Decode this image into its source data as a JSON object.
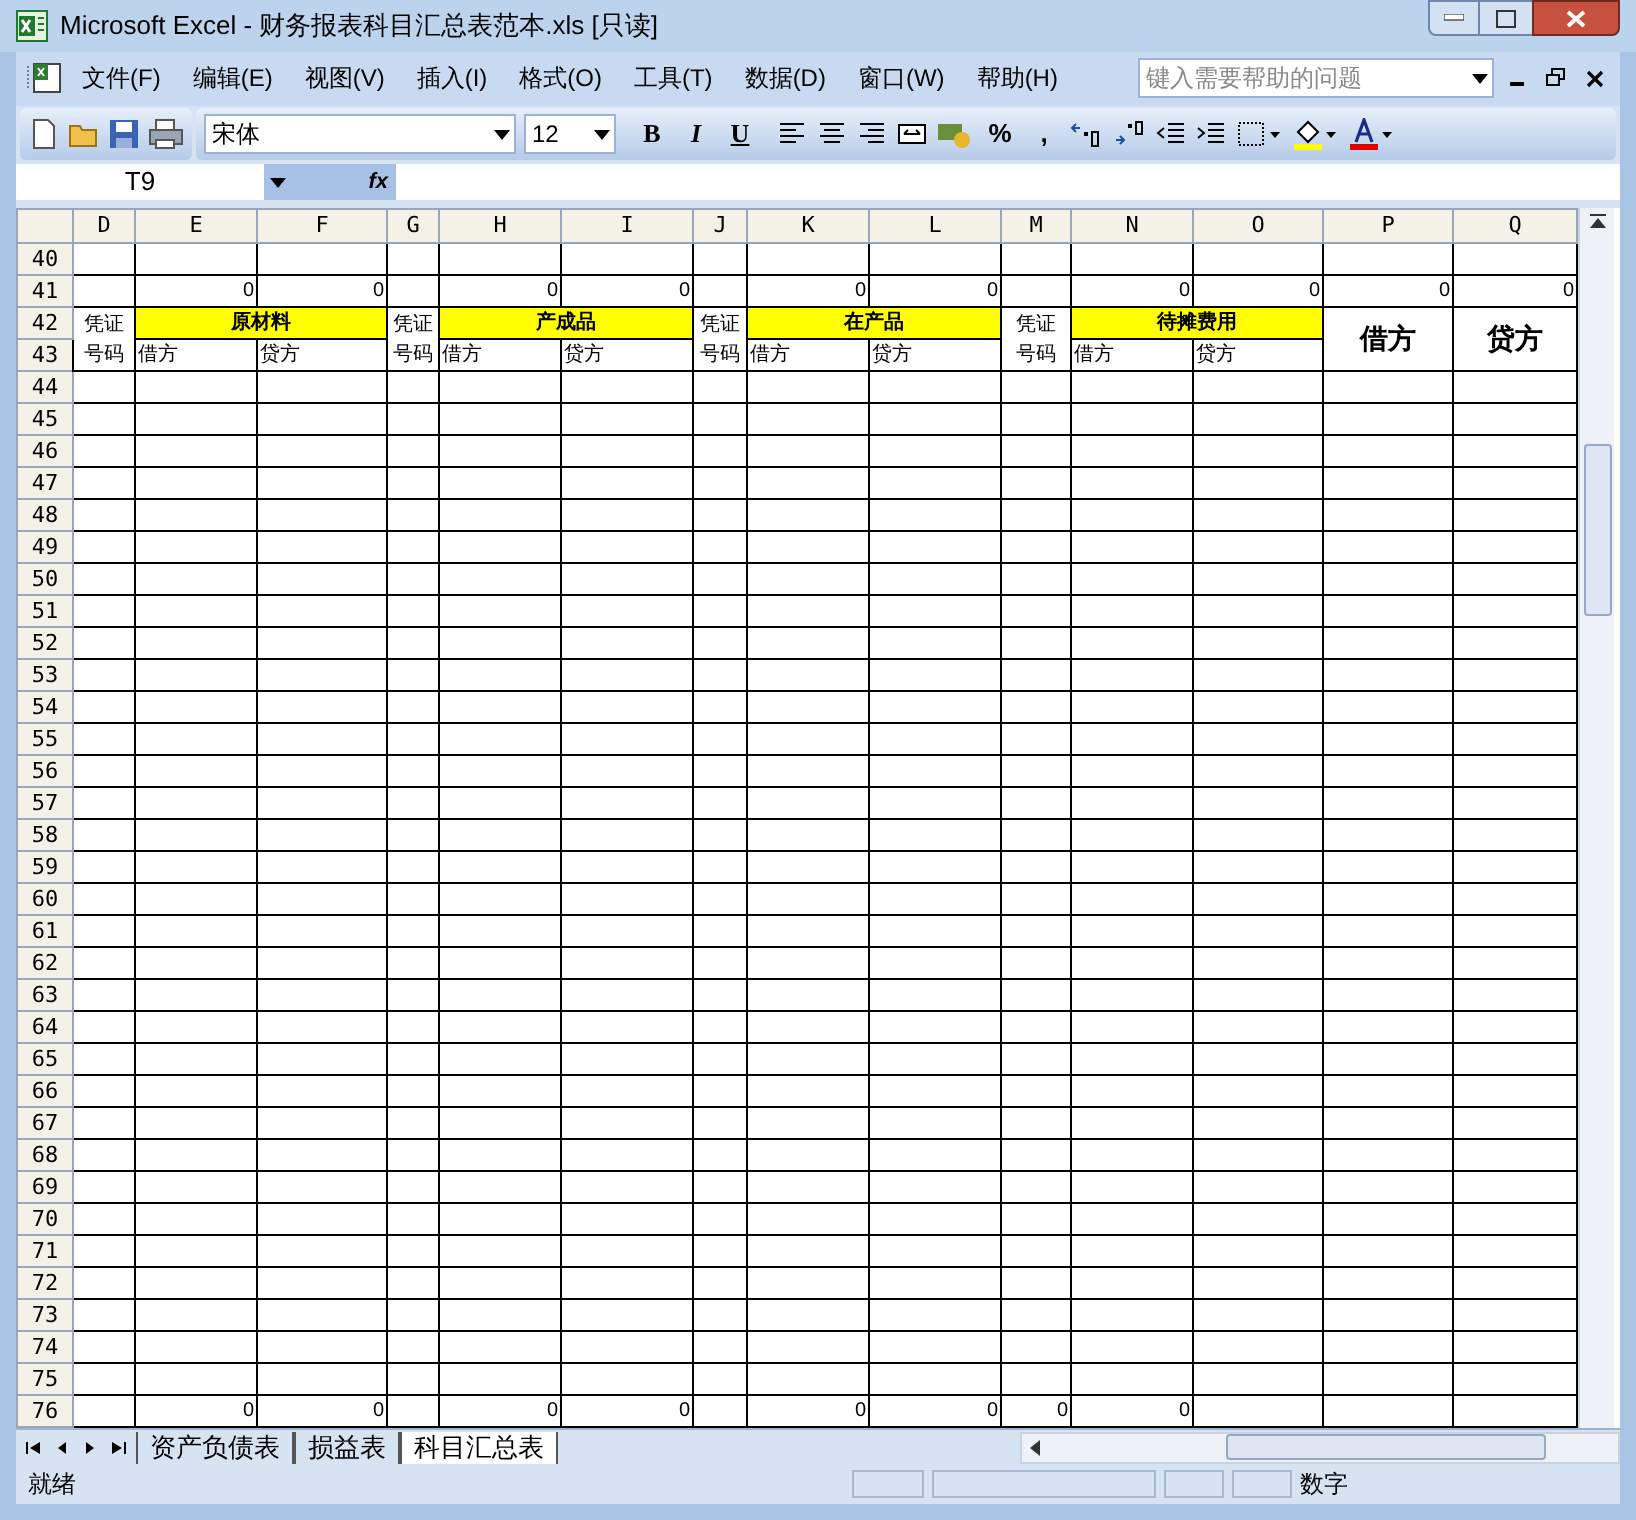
{
  "window": {
    "title": "Microsoft Excel - 财务报表科目汇总表范本.xls  [只读]"
  },
  "menu": [
    "文件(F)",
    "编辑(E)",
    "视图(V)",
    "插入(I)",
    "格式(O)",
    "工具(T)",
    "数据(D)",
    "窗口(W)",
    "帮助(H)"
  ],
  "help_search": {
    "placeholder": "键入需要帮助的问题"
  },
  "toolbar": {
    "font": "宋体",
    "size": "12",
    "format_buttons": [
      "B",
      "I",
      "U"
    ],
    "number_buttons": [
      "%",
      ","
    ]
  },
  "formula_bar": {
    "name_box": "T9",
    "fx": "fx"
  },
  "sheet": {
    "columns": [
      "D",
      "E",
      "F",
      "G",
      "H",
      "I",
      "J",
      "K",
      "L",
      "M",
      "N",
      "O",
      "P",
      "Q"
    ],
    "rows": [
      {
        "kind": "data",
        "header": "40"
      },
      {
        "kind": "data",
        "header": "41",
        "cells": {
          "E": "0",
          "F": "0",
          "H": "0",
          "I": "0",
          "K": "0",
          "L": "0",
          "N": "0",
          "O": "0",
          "P": "0",
          "Q": "0"
        }
      },
      {
        "kind": "label_block",
        "headers": [
          "42",
          "43"
        ],
        "groups": [
          {
            "voucher": "凭证号码",
            "title": "原材料",
            "debit": "借方",
            "credit": "贷方"
          },
          {
            "voucher": "凭证号码",
            "title": "产成品",
            "debit": "借方",
            "credit": "贷方"
          },
          {
            "voucher": "凭证号码",
            "title": "在产品",
            "debit": "借方",
            "credit": "贷方"
          },
          {
            "voucher": "凭证号码",
            "title": "待摊费用",
            "debit": "借方",
            "credit": "贷方"
          }
        ],
        "totals": [
          "借方",
          "贷方"
        ]
      },
      {
        "kind": "data",
        "header": "44"
      },
      {
        "kind": "data",
        "header": "45"
      },
      {
        "kind": "data",
        "header": "46"
      },
      {
        "kind": "data",
        "header": "47"
      },
      {
        "kind": "data",
        "header": "48"
      },
      {
        "kind": "data",
        "header": "49"
      },
      {
        "kind": "data",
        "header": "50"
      },
      {
        "kind": "data",
        "header": "51"
      },
      {
        "kind": "data",
        "header": "52"
      },
      {
        "kind": "data",
        "header": "53"
      },
      {
        "kind": "data",
        "header": "54"
      },
      {
        "kind": "data",
        "header": "55"
      },
      {
        "kind": "data",
        "header": "56"
      },
      {
        "kind": "data",
        "header": "57"
      },
      {
        "kind": "data",
        "header": "58"
      },
      {
        "kind": "data",
        "header": "59"
      },
      {
        "kind": "data",
        "header": "60"
      },
      {
        "kind": "data",
        "header": "61"
      },
      {
        "kind": "data",
        "header": "62"
      },
      {
        "kind": "data",
        "header": "63"
      },
      {
        "kind": "data",
        "header": "64"
      },
      {
        "kind": "data",
        "header": "65"
      },
      {
        "kind": "data",
        "header": "66"
      },
      {
        "kind": "data",
        "header": "67"
      },
      {
        "kind": "data",
        "header": "68"
      },
      {
        "kind": "data",
        "header": "69"
      },
      {
        "kind": "data",
        "header": "70"
      },
      {
        "kind": "data",
        "header": "71"
      },
      {
        "kind": "data",
        "header": "72"
      },
      {
        "kind": "data",
        "header": "73"
      },
      {
        "kind": "data",
        "header": "74"
      },
      {
        "kind": "data",
        "header": "75"
      },
      {
        "kind": "data",
        "header": "76",
        "cells": {
          "E": "0",
          "F": "0",
          "H": "0",
          "I": "0",
          "K": "0",
          "L": "0",
          "M": "0",
          "N": "0"
        }
      }
    ]
  },
  "sheet_tabs": [
    {
      "label": "资产负债表",
      "selected": false
    },
    {
      "label": "损益表",
      "selected": false
    },
    {
      "label": "科目汇总表",
      "selected": true
    }
  ],
  "status_bar": {
    "left": "就绪",
    "mode": "数字"
  }
}
